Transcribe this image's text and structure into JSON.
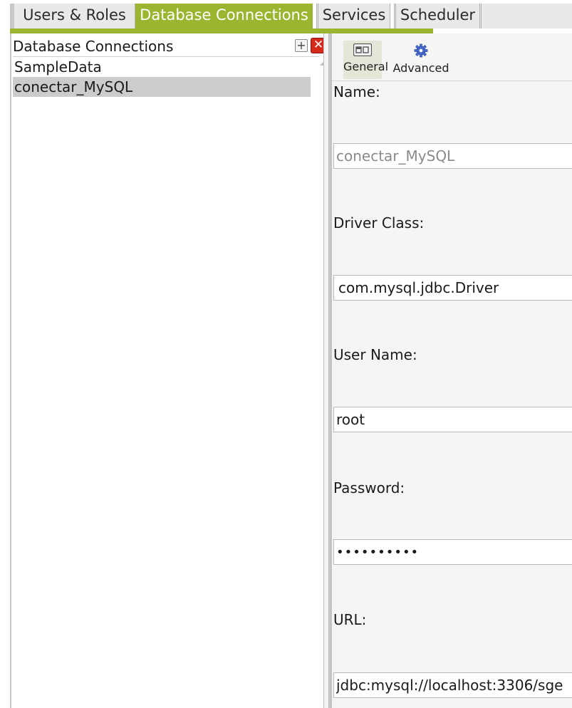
{
  "tabs": {
    "users_roles": "Users & Roles",
    "database_connections": "Database Connections",
    "services": "Services",
    "scheduler": "Scheduler"
  },
  "left_panel": {
    "title": "Database Connections",
    "add_icon": "plus-icon",
    "delete_icon": "close-icon",
    "connections": [
      {
        "label": "SampleData",
        "selected": false
      },
      {
        "label": "conectar_MySQL",
        "selected": true
      }
    ]
  },
  "toolbar": {
    "general_label": "General",
    "general_icon": "general-settings-icon",
    "advanced_label": "Advanced",
    "advanced_icon": "gear-icon"
  },
  "form": {
    "name_label": "Name:",
    "name_value": "conectar_MySQL",
    "driver_label": "Driver Class:",
    "driver_value": "com.mysql.jdbc.Driver",
    "username_label": "User Name:",
    "username_value": "root",
    "password_label": "Password:",
    "password_value": "••••••••••",
    "url_label": "URL:",
    "url_value": "jdbc:mysql://localhost:3306/sge"
  },
  "colors": {
    "accent": "#9cb530",
    "selected_row": "#cccccc",
    "delete_button": "#d42a1c"
  }
}
